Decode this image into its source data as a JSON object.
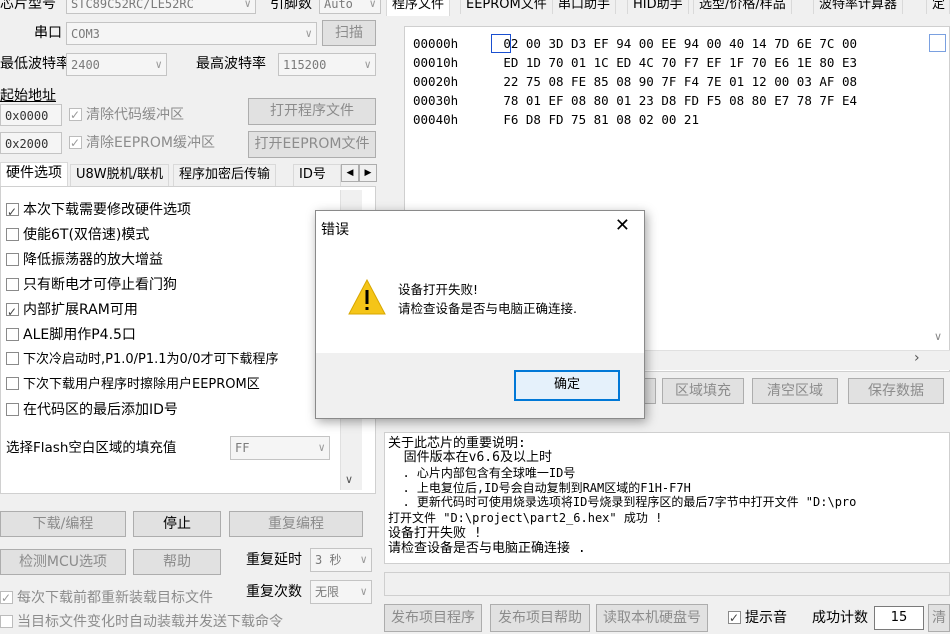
{
  "left": {
    "chip_model_label": "芯片型号",
    "chip_model_value": "STC89C52RC/LE52RC",
    "pin_label": "引脚数",
    "pin_value": "Auto",
    "port_label": "串口",
    "port_value": "COM3",
    "scan_button": "扫描",
    "min_baud_label": "最低波特率",
    "min_baud_value": "2400",
    "max_baud_label": "最高波特率",
    "max_baud_value": "115200",
    "start_addr_label": "起始地址",
    "addr1": "0x0000",
    "clear_code_label": "清除代码缓冲区",
    "open_program_button": "打开程序文件",
    "addr2": "0x2000",
    "clear_eeprom_label": "清除EEPROM缓冲区",
    "open_eeprom_button": "打开EEPROM文件",
    "tabs": [
      "硬件选项",
      "U8W脱机/联机",
      "程序加密后传输",
      "ID号"
    ],
    "options": [
      {
        "label": "本次下载需要修改硬件选项",
        "checked": true
      },
      {
        "label": "使能6T(双倍速)模式",
        "checked": false
      },
      {
        "label": "降低振荡器的放大增益",
        "checked": false
      },
      {
        "label": "只有断电才可停止看门狗",
        "checked": false
      },
      {
        "label": "内部扩展RAM可用",
        "checked": true
      },
      {
        "label": "ALE脚用作P4.5口",
        "checked": false
      },
      {
        "label": "下次冷启动时,P1.0/P1.1为0/0才可下载程序",
        "checked": false
      },
      {
        "label": "下次下载用户程序时擦除用户EEPROM区",
        "checked": false
      },
      {
        "label": "在代码区的最后添加ID号",
        "checked": false
      }
    ],
    "fill_label": "选择Flash空白区域的填充值",
    "fill_value": "FF",
    "download_button": "下载/编程",
    "stop_button": "停止",
    "reprogram_button": "重复编程",
    "detect_button": "检测MCU选项",
    "help_button": "帮助",
    "repeat_delay_label": "重复延时",
    "repeat_delay_value": "3 秒",
    "repeat_count_label": "重复次数",
    "repeat_count_value": "无限",
    "reload_label": "每次下载前都重新装载目标文件",
    "auto_send_label": "当目标文件变化时自动装载并发送下载命令"
  },
  "right": {
    "tabs": [
      "程序文件",
      "EEPROM文件",
      "串口助手",
      "HID助手",
      "选型/价格/样品",
      "波特率计算器",
      "定"
    ],
    "hex_rows": [
      {
        "addr": "00000h",
        "bytes": "02 00 3D D3 EF 94 00 EE 94 00 40 14 7D 6E 7C 00"
      },
      {
        "addr": "00010h",
        "bytes": "ED 1D 70 01 1C ED 4C 70 F7 EF 1F 70 E6 1E 80 E3"
      },
      {
        "addr": "00020h",
        "bytes": "22 75 08 FE 85 08 90 7F F4 7E 01 12 00 03 AF 08"
      },
      {
        "addr": "00030h",
        "bytes": "78 01 EF 08 80 01 23 D8 FD F5 08 80 E7 78 7F E4"
      },
      {
        "addr": "00040h",
        "bytes": "F6 D8 FD 75 81 08 02 00 21"
      }
    ],
    "fill_area_button": "区域填充",
    "clear_area_button": "清空区域",
    "save_data_button": "保存数据",
    "info_lines": [
      "关于此芯片的重要说明:",
      "  固件版本在v6.6及以上时",
      "  . 心片内部包含有全球唯一ID号",
      "  . 上电复位后,ID号会自动复制到RAM区域的F1H-F7H",
      "  . 更新代码时可使用烧录选项将ID号烧录到程序区的最后7字节中打开文件 \"D:\\pro",
      "打开文件 \"D:\\project\\part2_6.hex\" 成功 !",
      "设备打开失败 !",
      "请检查设备是否与电脑正确连接 ."
    ],
    "publish_program_button": "发布项目程序",
    "publish_help_button": "发布项目帮助",
    "read_disk_button": "读取本机硬盘号",
    "beep_label": "提示音",
    "success_count_label": "成功计数",
    "success_count_value": "15",
    "clear_button": "清"
  },
  "dialog": {
    "title": "错误",
    "message_line1": "设备打开失败!",
    "message_line2": "请检查设备是否与电脑正确连接.",
    "ok_button": "确定"
  }
}
